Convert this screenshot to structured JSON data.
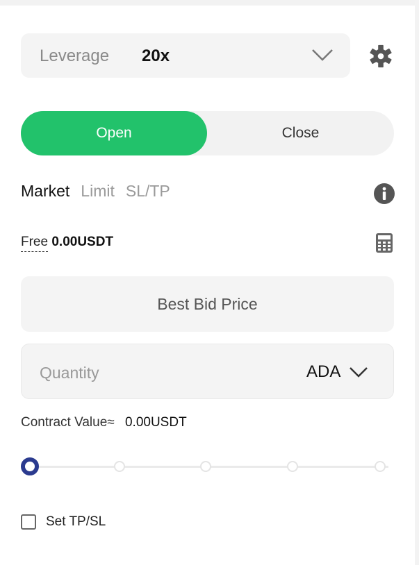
{
  "leverage": {
    "label": "Leverage",
    "value": "20x"
  },
  "mode_toggle": {
    "open_label": "Open",
    "close_label": "Close",
    "selected": "Open"
  },
  "order_tabs": [
    {
      "label": "Market",
      "active": true
    },
    {
      "label": "Limit",
      "active": false
    },
    {
      "label": "SL/TP",
      "active": false
    }
  ],
  "balance": {
    "label": "Free",
    "value": "0.00USDT"
  },
  "price_field": {
    "text": "Best Bid Price"
  },
  "quantity_field": {
    "placeholder": "Quantity",
    "value": "",
    "unit": "ADA"
  },
  "contract_value": {
    "label": "Contract Value≈",
    "value": "0.00USDT"
  },
  "slider": {
    "value_percent": 0,
    "stops": 5
  },
  "tpsl": {
    "label": "Set TP/SL",
    "checked": false
  },
  "colors": {
    "accent_green": "#22c26b",
    "slider_knob": "#2b3b8f",
    "field_bg": "#f4f4f4"
  },
  "icons": [
    "chevron-down-icon",
    "gear-icon",
    "info-icon",
    "calculator-icon",
    "chevron-down-icon"
  ]
}
